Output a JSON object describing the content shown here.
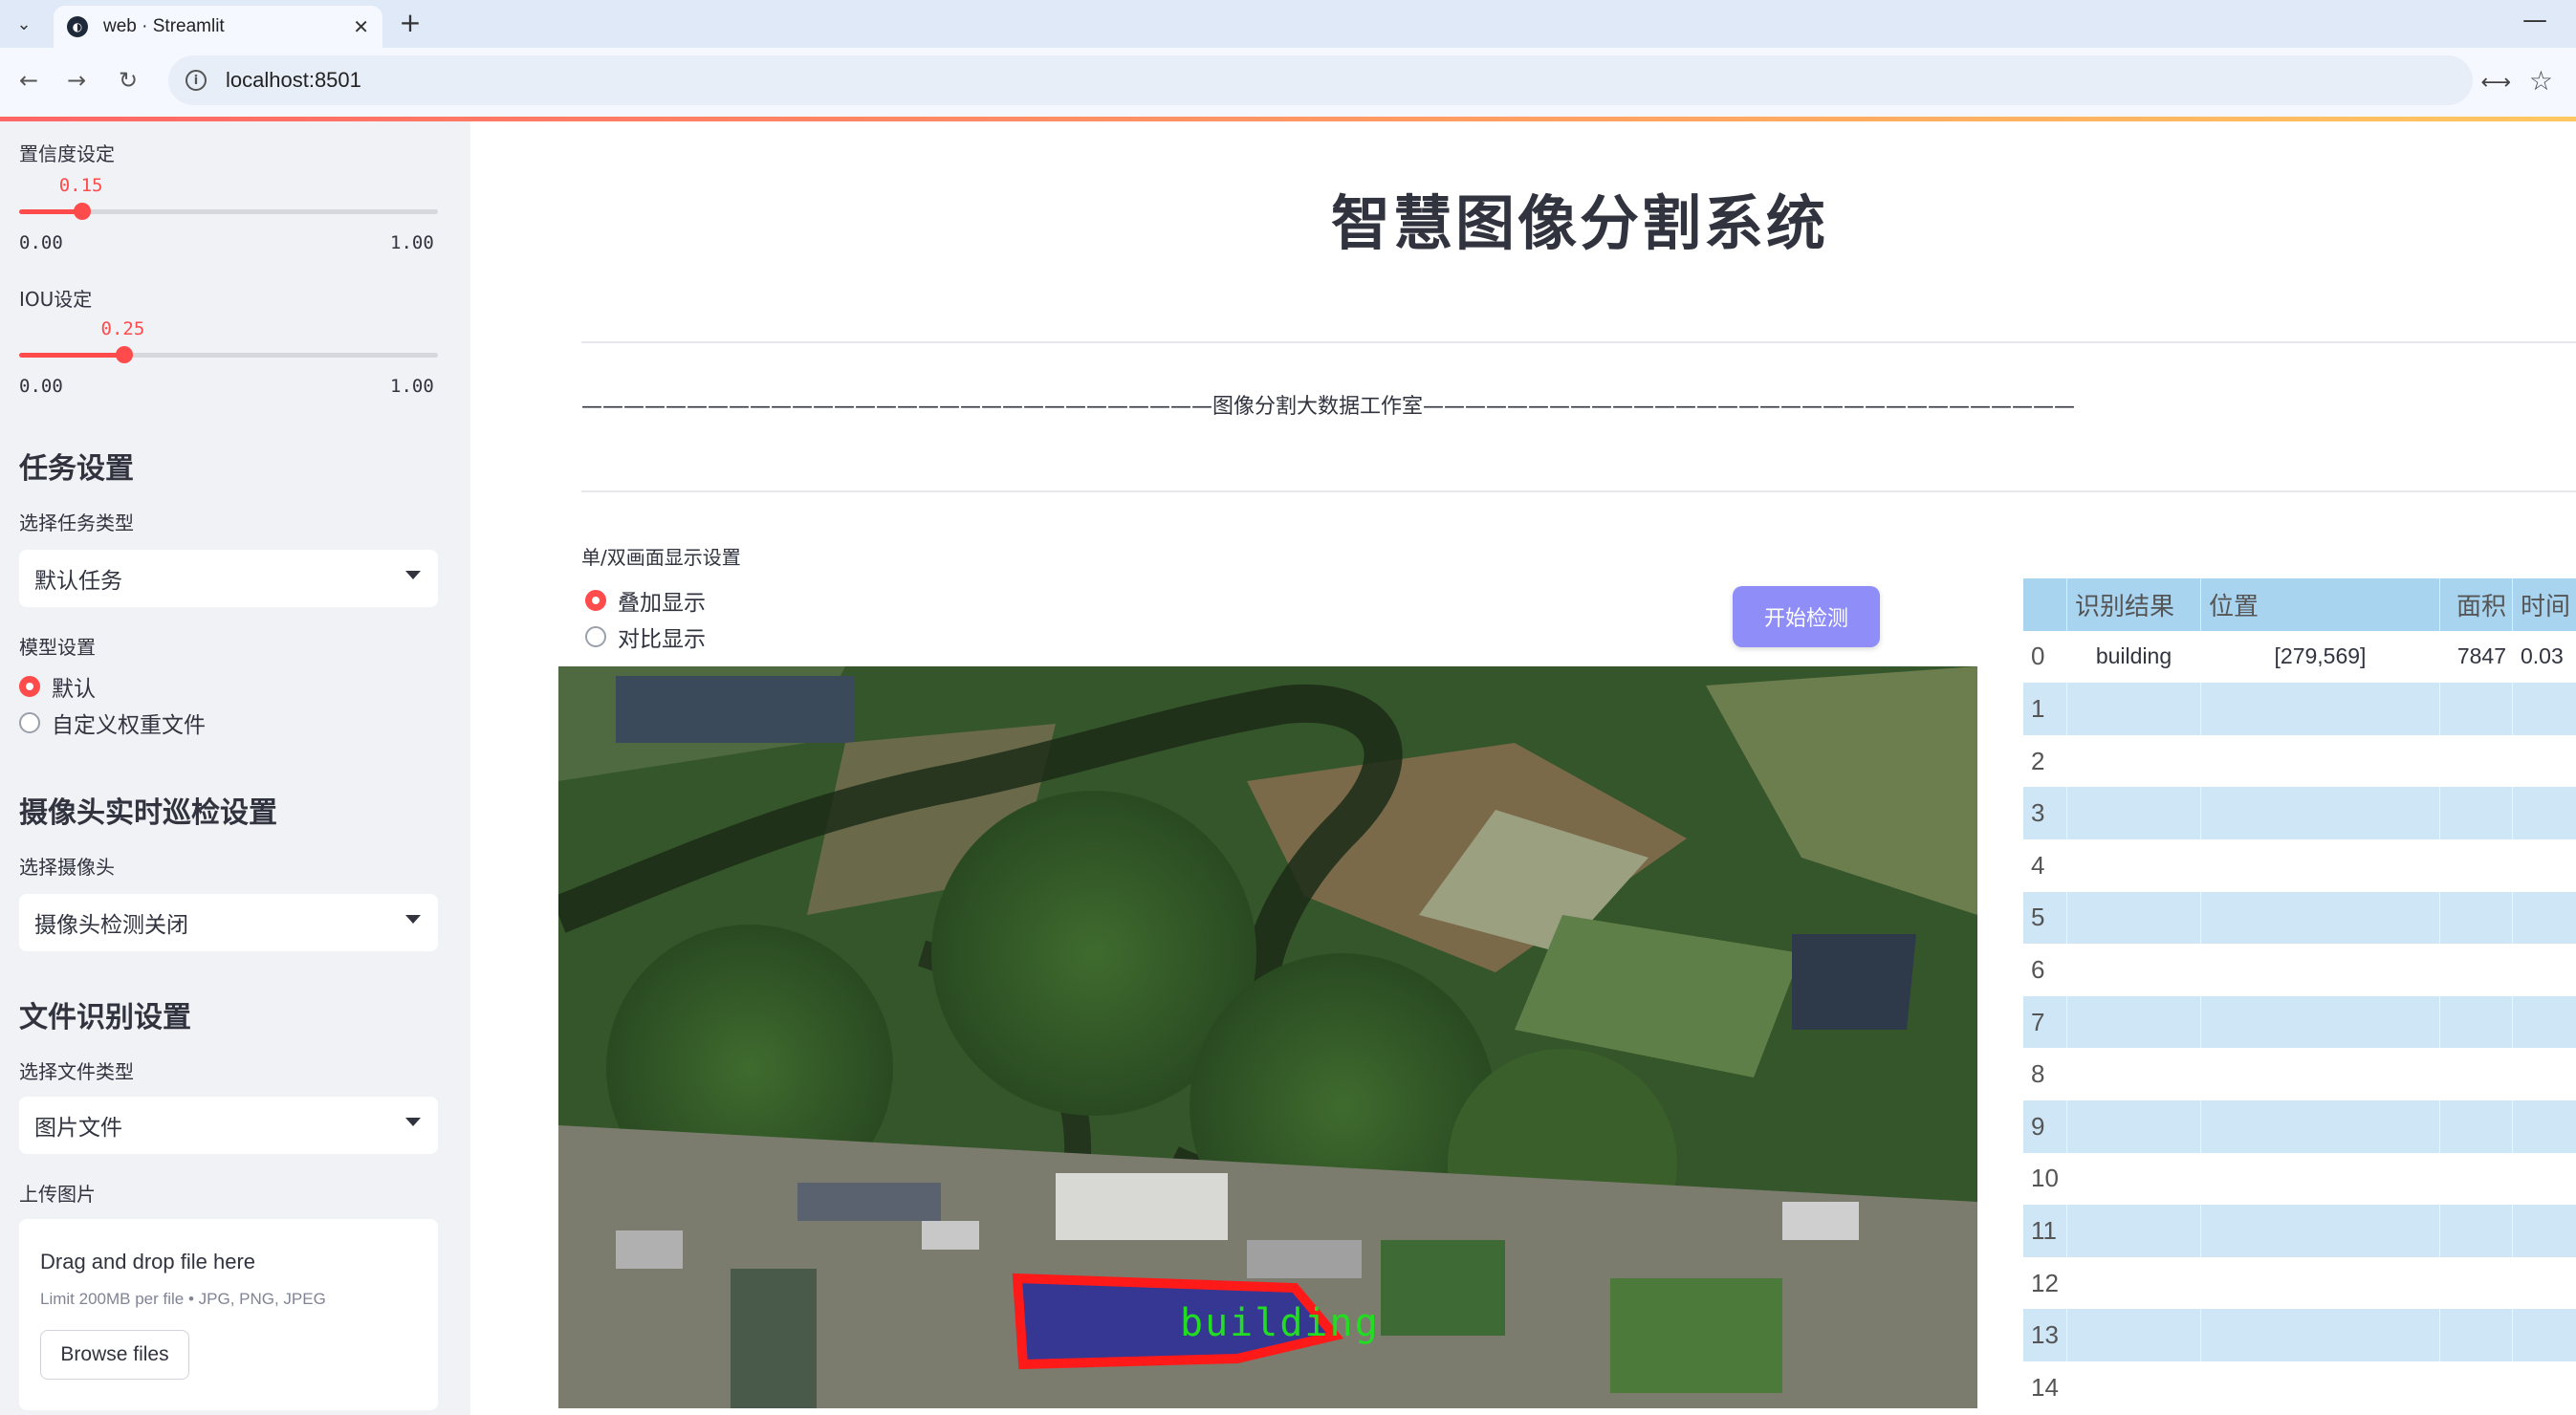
{
  "browser": {
    "tab_title": "web · Streamlit",
    "url": "localhost:8501"
  },
  "sidebar": {
    "confidence": {
      "label": "置信度设定",
      "value_text": "0.15",
      "min_text": "0.00",
      "max_text": "1.00",
      "value": 0.15
    },
    "iou": {
      "label": "IOU设定",
      "value_text": "0.25",
      "min_text": "0.00",
      "max_text": "1.00",
      "value": 0.25
    },
    "task": {
      "heading": "任务设置",
      "select_label": "选择任务类型",
      "selected": "默认任务"
    },
    "model": {
      "label": "模型设置",
      "options": [
        "默认",
        "自定义权重文件"
      ],
      "selected_index": 0
    },
    "camera": {
      "heading": "摄像头实时巡检设置",
      "select_label": "选择摄像头",
      "selected": "摄像头检测关闭"
    },
    "file": {
      "heading": "文件识别设置",
      "select_label": "选择文件类型",
      "selected": "图片文件",
      "upload_label": "上传图片"
    },
    "uploader": {
      "title": "Drag and drop file here",
      "subtitle": "Limit 200MB per file • JPG, PNG, JPEG",
      "button": "Browse files"
    }
  },
  "main": {
    "title": "智慧图像分割系统",
    "studio_line": "——————————————————————————————图像分割大数据工作室———————————————————————————————",
    "display_mode": {
      "label": "单/双画面显示设置",
      "options": [
        "叠加显示",
        "对比显示"
      ],
      "selected_index": 0
    },
    "start_button": "开始检测",
    "detection_label": "building"
  },
  "results_table": {
    "columns": [
      "",
      "识别结果",
      "位置",
      "面积",
      "时间"
    ],
    "rows": [
      {
        "index": "0",
        "result": "building",
        "position": "[279,569]",
        "area": "7847",
        "time": "0.03"
      },
      {
        "index": "1",
        "result": "",
        "position": "",
        "area": "",
        "time": ""
      },
      {
        "index": "2",
        "result": "",
        "position": "",
        "area": "",
        "time": ""
      },
      {
        "index": "3",
        "result": "",
        "position": "",
        "area": "",
        "time": ""
      },
      {
        "index": "4",
        "result": "",
        "position": "",
        "area": "",
        "time": ""
      },
      {
        "index": "5",
        "result": "",
        "position": "",
        "area": "",
        "time": ""
      },
      {
        "index": "6",
        "result": "",
        "position": "",
        "area": "",
        "time": ""
      },
      {
        "index": "7",
        "result": "",
        "position": "",
        "area": "",
        "time": ""
      },
      {
        "index": "8",
        "result": "",
        "position": "",
        "area": "",
        "time": ""
      },
      {
        "index": "9",
        "result": "",
        "position": "",
        "area": "",
        "time": ""
      },
      {
        "index": "10",
        "result": "",
        "position": "",
        "area": "",
        "time": ""
      },
      {
        "index": "11",
        "result": "",
        "position": "",
        "area": "",
        "time": ""
      },
      {
        "index": "12",
        "result": "",
        "position": "",
        "area": "",
        "time": ""
      },
      {
        "index": "13",
        "result": "",
        "position": "",
        "area": "",
        "time": ""
      },
      {
        "index": "14",
        "result": "",
        "position": "",
        "area": "",
        "time": ""
      }
    ]
  },
  "colors": {
    "accent": "#ff4b4b",
    "sidebar_bg": "#f0f2f6",
    "button": "#8f8df8",
    "table_header": "#a8d4f0",
    "table_stripe": "#cfe6f7",
    "mask_outline": "#ff1a1a",
    "mask_fill": "#2a2a9a",
    "label_text": "#22dd22"
  }
}
